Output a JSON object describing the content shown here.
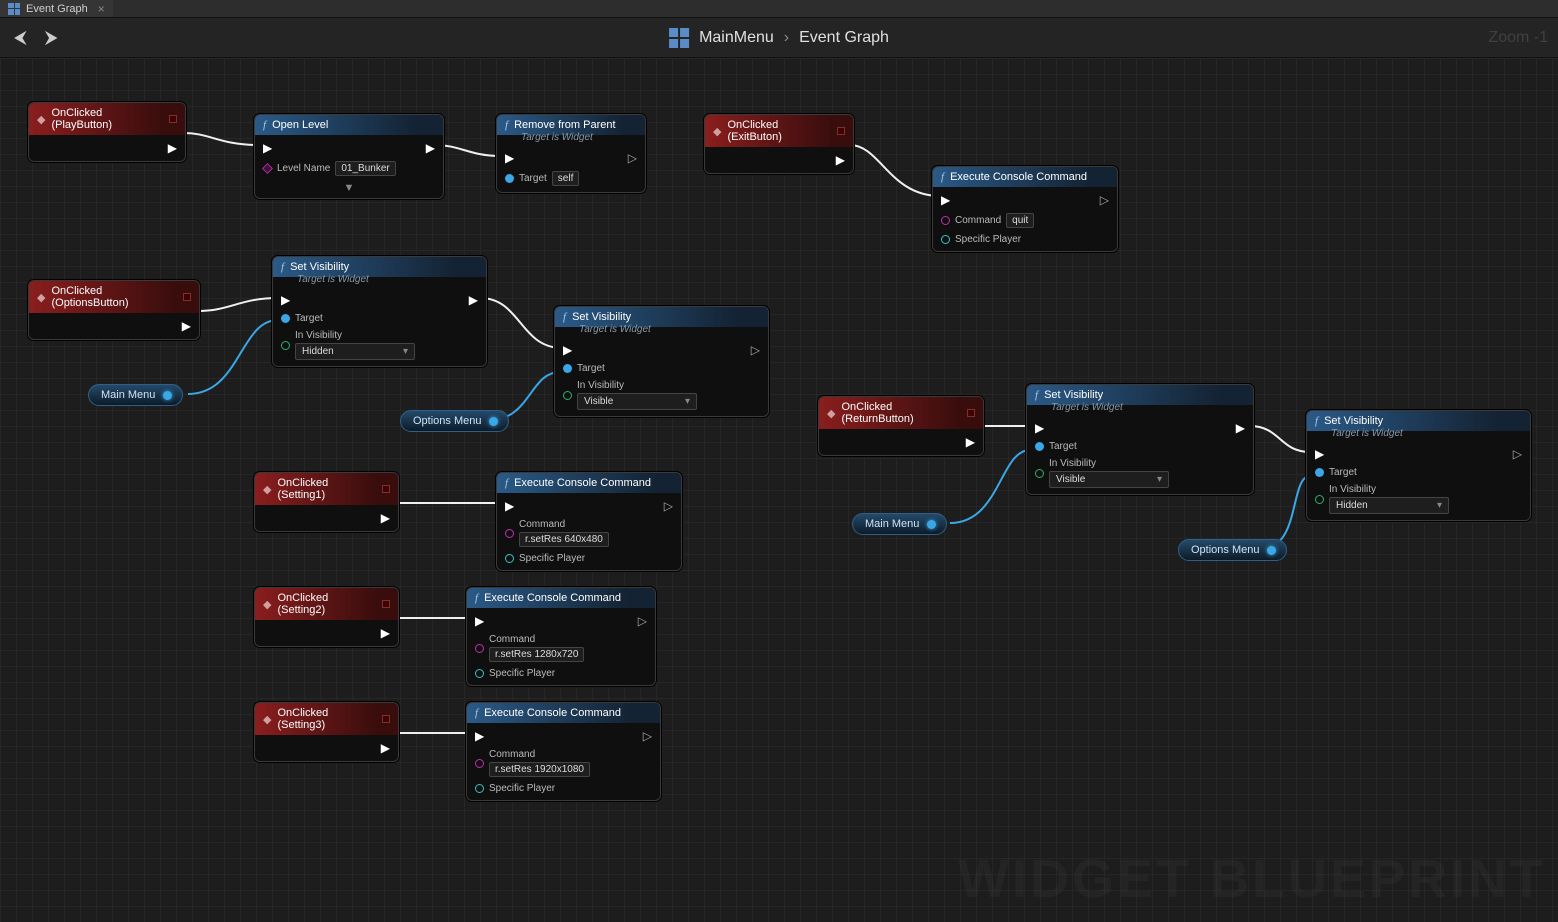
{
  "tab": {
    "title": "Event Graph",
    "close": "×"
  },
  "nav": {
    "back": "⮜",
    "forward": "⮞"
  },
  "breadcrumb": {
    "root": "MainMenu",
    "sep": "›",
    "leaf": "Event Graph"
  },
  "zoom": "Zoom -1",
  "watermark": "WIDGET BLUEPRINT",
  "labels": {
    "level_name": "Level Name",
    "target": "Target",
    "self": "self",
    "in_visibility": "In Visibility",
    "command": "Command",
    "specific_player": "Specific Player"
  },
  "nodes": {
    "play_evt": "OnClicked (PlayButton)",
    "open_level": {
      "title": "Open Level",
      "level": "01_Bunker"
    },
    "remove_parent": {
      "title": "Remove from Parent",
      "sub": "Target is Widget"
    },
    "exit_evt": "OnClicked (ExitButon)",
    "exec_quit": {
      "title": "Execute Console Command",
      "cmd": "quit"
    },
    "options_evt": "OnClicked (OptionsButton)",
    "setvis1": {
      "title": "Set Visibility",
      "sub": "Target is Widget",
      "opt": "Hidden"
    },
    "setvis2": {
      "title": "Set Visibility",
      "sub": "Target is Widget",
      "opt": "Visible"
    },
    "setting1_evt": "OnClicked (Setting1)",
    "exec_s1": {
      "title": "Execute Console Command",
      "cmd": "r.setRes 640x480"
    },
    "setting2_evt": "OnClicked (Setting2)",
    "exec_s2": {
      "title": "Execute Console Command",
      "cmd": "r.setRes 1280x720"
    },
    "setting3_evt": "OnClicked (Setting3)",
    "exec_s3": {
      "title": "Execute Console Command",
      "cmd": "r.setRes 1920x1080"
    },
    "return_evt": "OnClicked (ReturnButton)",
    "setvis3": {
      "title": "Set Visibility",
      "sub": "Target is Widget",
      "opt": "Visible"
    },
    "setvis4": {
      "title": "Set Visibility",
      "sub": "Target is Widget",
      "opt": "Hidden"
    }
  },
  "vars": {
    "mainmenu1": "Main Menu",
    "optionsmenu1": "Options Menu",
    "mainmenu2": "Main Menu",
    "optionsmenu2": "Options Menu"
  }
}
